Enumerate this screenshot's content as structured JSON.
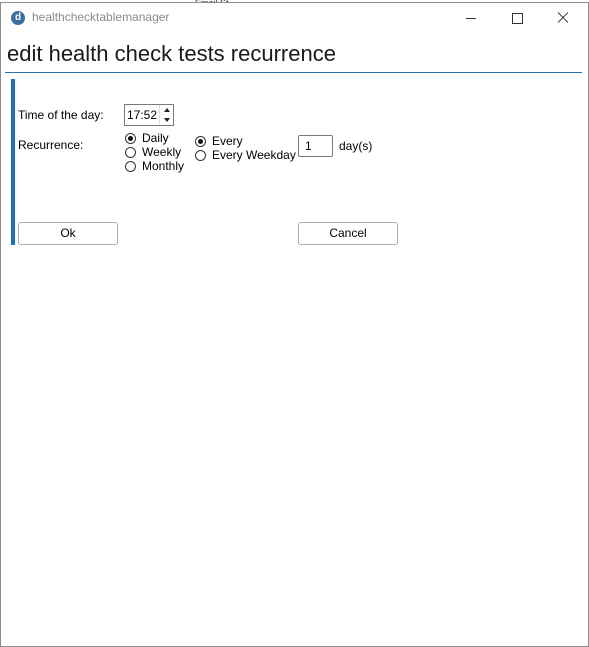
{
  "window": {
    "app_logo_letter": "d",
    "title": "healthchecktablemanager",
    "background_peek_text": "Email St..."
  },
  "page": {
    "heading": "edit health check tests recurrence"
  },
  "form": {
    "time_label": "Time of the day:",
    "time_value": "17:52",
    "recurrence_label": "Recurrence:",
    "recurrence_options": [
      {
        "label": "Daily",
        "selected": true
      },
      {
        "label": "Weekly",
        "selected": false
      },
      {
        "label": "Monthly",
        "selected": false
      }
    ],
    "daily_options": [
      {
        "label": "Every",
        "selected": true
      },
      {
        "label": "Every Weekday",
        "selected": false
      }
    ],
    "days_value": "1",
    "days_unit": "day(s)"
  },
  "buttons": {
    "ok": "Ok",
    "cancel": "Cancel"
  },
  "colors": {
    "accent": "#1f6fb5",
    "heading_rule": "#2e6ba6",
    "title_text": "#8a8a8a"
  }
}
